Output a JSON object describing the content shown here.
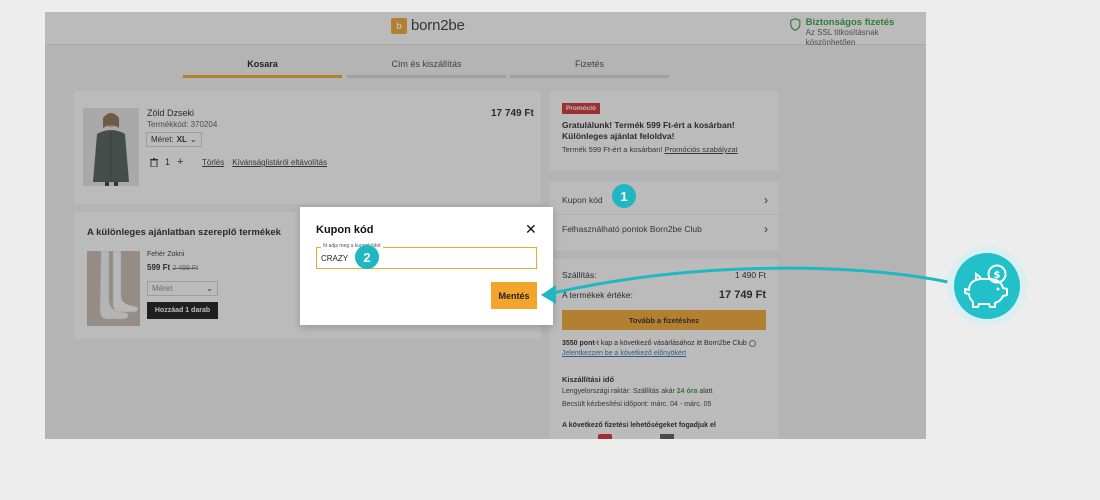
{
  "header": {
    "logo_mark": "b",
    "logo_text": "born2be",
    "secure_title": "Biztonságos fizetés",
    "secure_sub": "Az SSL titkosításnak köszönhetően"
  },
  "steps": [
    {
      "label": "Kosara",
      "active": true
    },
    {
      "label": "Cím és kiszállítás",
      "active": false
    },
    {
      "label": "Fizetés",
      "active": false
    }
  ],
  "cart_item": {
    "name": "Zöld Dzseki",
    "code": "Termékkód: 370204",
    "size_label": "Méret:",
    "size_value": "XL",
    "quantity": "1",
    "delete": "Törlés",
    "wishlist_remove": "Kívánságlistáról eltávolítás",
    "price": "17 749 Ft"
  },
  "offer": {
    "title": "A különleges ajánlatban szereplő termékek",
    "product_name": "Fehér Zokni",
    "price": "599 Ft",
    "old_price": "2 499 Ft",
    "size_placeholder": "Méret",
    "add_button": "Hozzáad 1 darab"
  },
  "promo": {
    "badge": "Promóció",
    "line1": "Gratulálunk! Termék 599 Ft-ért a kosárban!",
    "line2": "Különleges ajánlat feloldva!",
    "info": "Termék 599 Ft-ért a kosárban!",
    "rules_link": "Promóciós szabályzat"
  },
  "options": {
    "coupon": "Kupon kód",
    "points": "Felhasználható pontok Born2be Club"
  },
  "summary": {
    "shipping_label": "Szállítás:",
    "shipping_value": "1 490 Ft",
    "value_label": "A termékek értéke:",
    "value": "17 749 Ft",
    "checkout_button": "Tovább a fizetéshez",
    "points_bold": "3550 pont",
    "points_text": "-t kap a következő vásárlásához itt Born2be Club",
    "login_link": "Jelentkezzen be a következő előnyökért",
    "delivery_title": "Kiszállítási idő",
    "delivery_line1_pre": "Lengyelországi raktár: Szállítás akár ",
    "delivery_line1_hl": "24 óra",
    "delivery_line1_post": " alatt",
    "delivery_line2": "Becsült kézbesítési időpont: márc. 04 - márc. 05",
    "payment_title": "A következő fizetési lehetőségeket fogadjuk el"
  },
  "modal": {
    "title": "Kupon kód",
    "field_label": "Itt adja meg a kuponkódot",
    "field_value": "CRAZY",
    "save_button": "Mentés"
  },
  "callouts": [
    "1",
    "2"
  ],
  "colors": {
    "accent": "#f2a52a",
    "teal": "#1fb8c2",
    "promo_red": "#d02a2a",
    "secure_green": "#2a9d3c"
  }
}
